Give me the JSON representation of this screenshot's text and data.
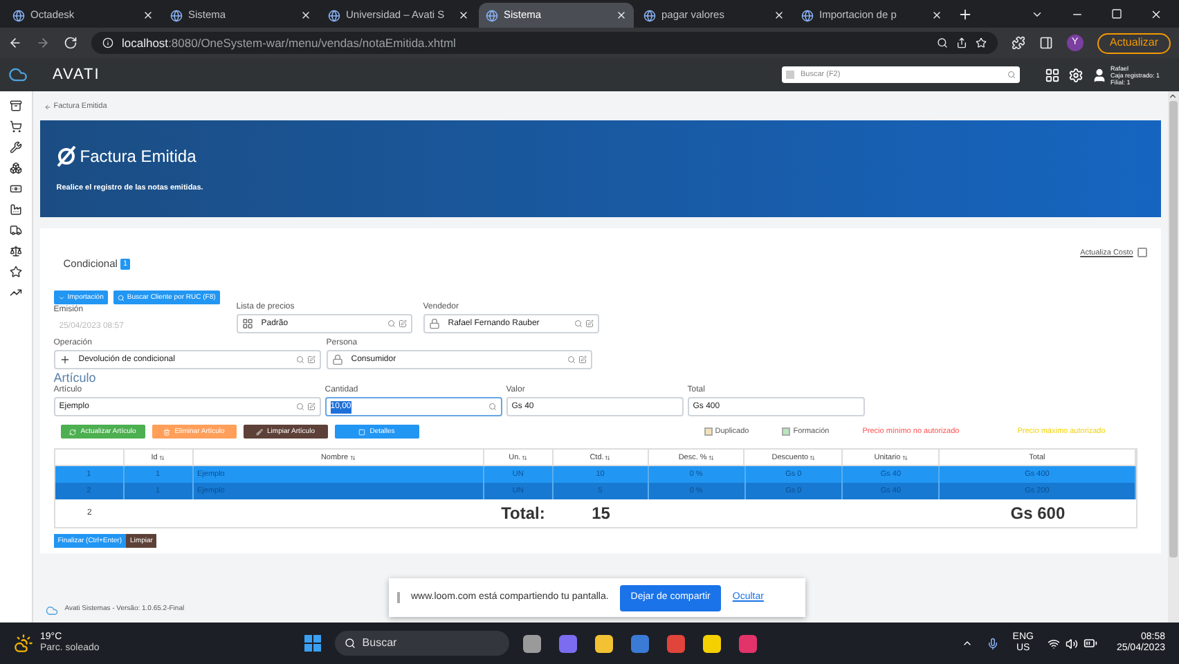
{
  "browser": {
    "tabs": [
      {
        "title": "Octadesk",
        "selected": false
      },
      {
        "title": "Sistema",
        "selected": false
      },
      {
        "title": "Universidad – Avati S",
        "selected": false
      },
      {
        "title": "Sistema",
        "selected": true
      },
      {
        "title": "pagar valores",
        "selected": false
      },
      {
        "title": "Importacion de p",
        "selected": false
      }
    ],
    "url_host": "localhost",
    "url_rest": ":8080/OneSystem-war/menu/vendas/notaEmitida.xhtml",
    "update_button": "Actualizar",
    "profile_letter": "Y"
  },
  "app_header": {
    "logo": "AVATI",
    "search": {
      "placeholder": "Buscar (F2)"
    },
    "user": [
      "Rafael",
      "Caja registrado: 1",
      "Filial: 1"
    ]
  },
  "breadcrumb": "Factura Emitida",
  "banner": {
    "title": "Factura Emitida",
    "subtitle": "Realice el registro de las notas emitidas."
  },
  "form": {
    "mode_label": "Condicional",
    "mode_badge": "1",
    "update_cost": {
      "label": "Actualiza Costo",
      "checked": false
    },
    "top_buttons": [
      {
        "label": "Importación",
        "kind": "dropdown"
      },
      {
        "label": "Buscar Cliente por RUC (F8)",
        "kind": "search"
      }
    ],
    "emission": {
      "label": "Emisión",
      "value": "25/04/2023 08:57",
      "disabled": true
    },
    "price_list": {
      "label": "Lista de precios",
      "value": "Padrão"
    },
    "seller": {
      "label": "Vendedor",
      "value": "Rafael Fernando Rauber"
    },
    "operation": {
      "label": "Operación",
      "value": "Devolución de condicional"
    },
    "person": {
      "label": "Persona",
      "value": "Consumidor"
    }
  },
  "article": {
    "title": "Artículo",
    "item": {
      "label": "Artículo",
      "value": "Ejemplo"
    },
    "quantity": {
      "label": "Cantidad",
      "value": "10,00",
      "selected": true
    },
    "value": {
      "label": "Valor",
      "value": "Gs 40"
    },
    "total": {
      "label": "Total",
      "value": "Gs 400"
    },
    "buttons": [
      {
        "label": "Actualizar Artículo",
        "color": "#4caf50",
        "kind": "refresh"
      },
      {
        "label": "Eliminar Artículo",
        "color": "#ff9f5a",
        "kind": "trash"
      },
      {
        "label": "Limpiar Artículo",
        "color": "#5d4037",
        "kind": "brush"
      },
      {
        "label": "Detalles",
        "color": "#2196f3",
        "kind": "square"
      }
    ],
    "legend": [
      {
        "label": "Duplicado",
        "kind": "box",
        "color": "#f3e2b8"
      },
      {
        "label": "Formación",
        "kind": "box",
        "color": "#b9e4c0"
      },
      {
        "label": "Precio mínimo no autorizado",
        "kind": "text",
        "color": "#ff4d4d"
      },
      {
        "label": "Precio máximo autorizado",
        "kind": "text",
        "color": "#f2d200"
      }
    ]
  },
  "table": {
    "columns": [
      "",
      "Id",
      "Nombre",
      "Un.",
      "Ctd.",
      "Desc. %",
      "Descuento",
      "Unitario",
      "Total"
    ],
    "sortable": [
      false,
      true,
      true,
      true,
      true,
      true,
      true,
      true,
      false
    ],
    "rows": [
      {
        "cells": [
          "1",
          "1",
          "Ejemplo",
          "UN",
          "10",
          "0 %",
          "Gs 0",
          "Gs 40",
          "Gs 400"
        ],
        "selected": true,
        "hover": false
      },
      {
        "cells": [
          "2",
          "1",
          "Ejemplo",
          "UN",
          "5",
          "0 %",
          "Gs 0",
          "Gs 40",
          "Gs 200"
        ],
        "selected": true,
        "hover": true
      }
    ],
    "footer": {
      "count": "2",
      "total_label": "Total:",
      "quantity": "15",
      "amount": "Gs 600"
    }
  },
  "bottom_buttons": [
    {
      "label": "Finalizar (Ctrl+Enter)",
      "color": "#2196f3"
    },
    {
      "label": "Limpiar",
      "color": "#5d4037"
    }
  ],
  "footer": "Avati Sistemas - Versão: 1.0.65.2-Final",
  "loom": {
    "message": "www.loom.com está compartiendo tu pantalla.",
    "button": "Dejar de compartir",
    "link": "Ocultar"
  },
  "taskbar": {
    "temperature": "19°C",
    "weather": "Parc. soleado",
    "search": "Buscar",
    "language": "ENG",
    "region": "US",
    "time": "08:58",
    "date": "25/04/2023"
  }
}
